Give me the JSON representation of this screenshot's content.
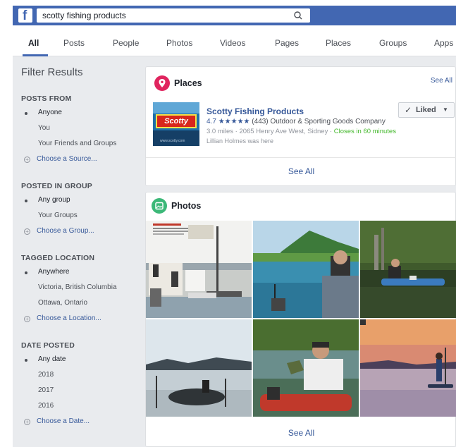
{
  "header": {
    "logo": "f",
    "search_query": "scotty fishing products"
  },
  "tabs": [
    {
      "label": "All",
      "active": true
    },
    {
      "label": "Posts"
    },
    {
      "label": "People"
    },
    {
      "label": "Photos"
    },
    {
      "label": "Videos"
    },
    {
      "label": "Pages"
    },
    {
      "label": "Places"
    },
    {
      "label": "Groups"
    },
    {
      "label": "Apps"
    }
  ],
  "filters": {
    "title": "Filter Results",
    "sections": [
      {
        "heading": "POSTS FROM",
        "options": [
          "Anyone",
          "You",
          "Your Friends and Groups"
        ],
        "selected": 0,
        "link": "Choose a Source..."
      },
      {
        "heading": "POSTED IN GROUP",
        "options": [
          "Any group",
          "Your Groups"
        ],
        "selected": 0,
        "link": "Choose a Group..."
      },
      {
        "heading": "TAGGED LOCATION",
        "options": [
          "Anywhere",
          "Victoria, British Columbia",
          "Ottawa, Ontario"
        ],
        "selected": 0,
        "link": "Choose a Location..."
      },
      {
        "heading": "DATE POSTED",
        "options": [
          "Any date",
          "2018",
          "2017",
          "2016"
        ],
        "selected": 0,
        "link": "Choose a Date..."
      }
    ]
  },
  "places": {
    "title": "Places",
    "see_all_top": "See All",
    "image_text": "Scotty",
    "image_site": "www.scotty.com",
    "name": "Scotty Fishing Products",
    "rating": "4.7",
    "stars": "★★★★★",
    "reviews": "(443)",
    "category": "Outdoor & Sporting Goods Company",
    "distance_address": "3.0 miles · 2065 Henry Ave West, Sidney · ",
    "hours": "Closes in 60 minutes",
    "friend_activity": "Lillian Holmes was here",
    "liked_label": "Liked",
    "see_all": "See All"
  },
  "photos": {
    "title": "Photos",
    "see_all": "See All"
  },
  "colors": {
    "brand": "#4267b2",
    "link": "#365899",
    "places_icon": "#e0245e",
    "photos_icon": "#3cb878",
    "open_green": "#42b72a"
  }
}
